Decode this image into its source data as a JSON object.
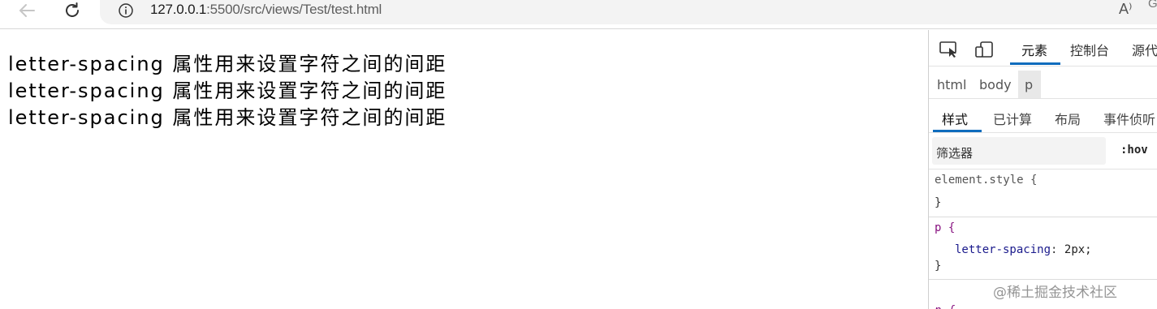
{
  "browser": {
    "back_icon": "arrow-left-icon",
    "reload_icon": "reload-icon",
    "info_icon": "info-circle-icon",
    "url_host": "127.0.0.1",
    "url_path": ":5500/src/views/Test/test.html",
    "read_aloud_label": "A⁾",
    "profile_partial": "G"
  },
  "page": {
    "lines": [
      "letter-spacing 属性用来设置字符之间的间距",
      "letter-spacing 属性用来设置字符之间的间距",
      "letter-spacing 属性用来设置字符之间的间距"
    ]
  },
  "devtools": {
    "tabs": [
      "元素",
      "控制台",
      "源代"
    ],
    "active_tab": "元素",
    "breadcrumbs": [
      "html",
      "body",
      "p"
    ],
    "sub_tabs": [
      "样式",
      "已计算",
      "布局",
      "事件侦听"
    ],
    "active_sub_tab": "样式",
    "filter_placeholder": "筛选器",
    "hov_label": ":hov",
    "rules": {
      "element_style_selector": "element.style {",
      "element_style_close": "}",
      "p_selector": "p {",
      "p_property": "letter-spacing",
      "p_colon": ":",
      "p_value": "2px;",
      "p_close": "}",
      "p2_selector": "p {"
    },
    "accent_color": "#0f6cbd"
  },
  "watermark": "@稀土掘金技术社区"
}
